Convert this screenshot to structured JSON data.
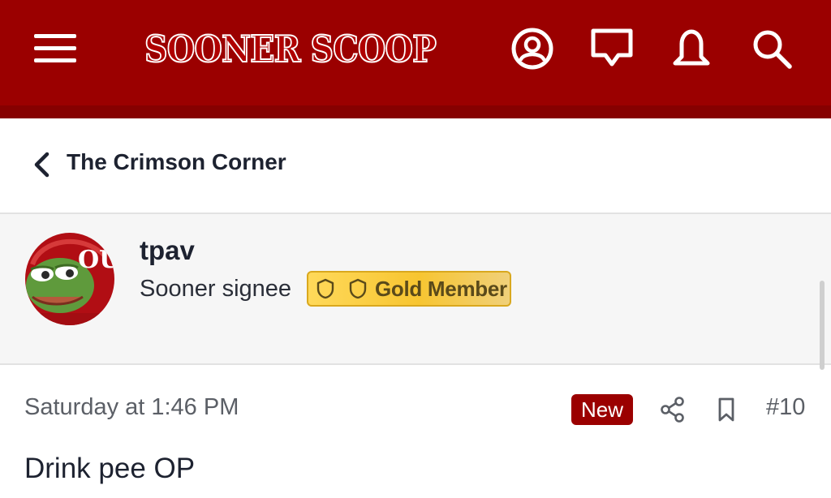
{
  "header": {
    "logo_text": "SOONER SCOOP",
    "icons": [
      "menu-icon",
      "account-icon",
      "messages-icon",
      "alerts-icon",
      "search-icon"
    ],
    "background_color": "#9b0000"
  },
  "breadcrumb": {
    "title": "The Crimson Corner"
  },
  "user": {
    "name": "tpav",
    "title": "Sooner signee",
    "badge_label": "Gold Member"
  },
  "post": {
    "date": "Saturday at 1:46 PM",
    "new_label": "New",
    "number": "#10",
    "body": "Drink pee OP"
  },
  "colors": {
    "brand": "#9b0000",
    "badge_gold": "#f7c531",
    "text_dark": "#1d2230",
    "text_muted": "#5b5f66"
  }
}
